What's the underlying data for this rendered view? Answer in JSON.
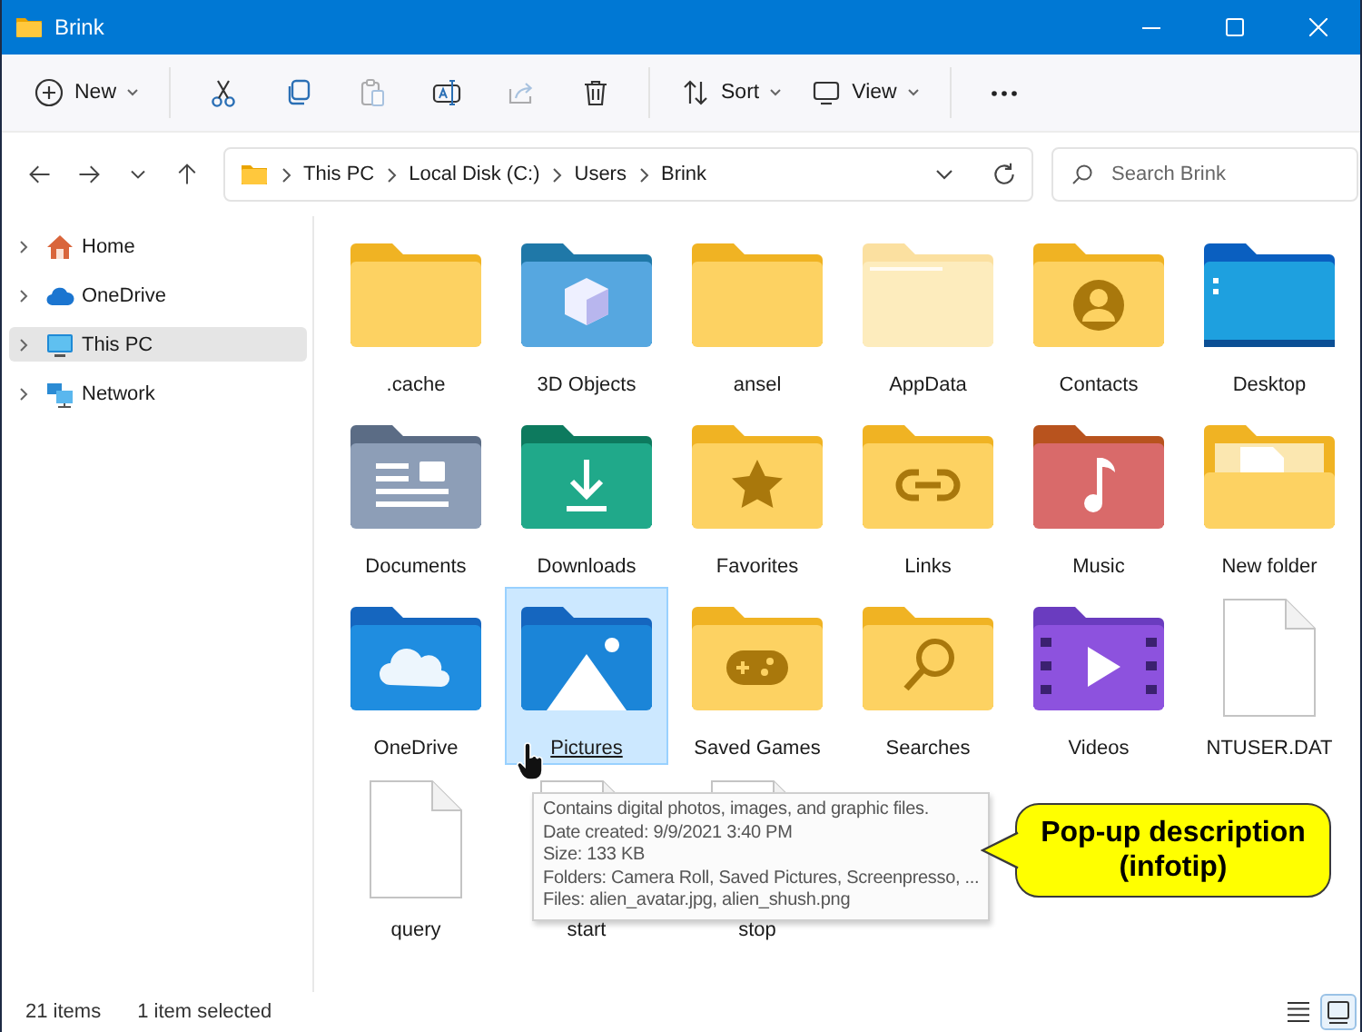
{
  "window": {
    "title": "Brink"
  },
  "toolbar": [
    {
      "kind": "new",
      "label": "New",
      "dropdown": true,
      "disabled": false
    },
    {
      "kind": "cut",
      "disabled": false
    },
    {
      "kind": "copy",
      "disabled": false
    },
    {
      "kind": "paste",
      "disabled": true
    },
    {
      "kind": "rename",
      "disabled": false
    },
    {
      "kind": "share",
      "disabled": true
    },
    {
      "kind": "delete",
      "disabled": false
    },
    {
      "kind": "sort",
      "label": "Sort",
      "dropdown": true,
      "disabled": false
    },
    {
      "kind": "view",
      "label": "View",
      "dropdown": true,
      "disabled": false
    },
    {
      "kind": "more",
      "disabled": false
    }
  ],
  "address": {
    "crumbs": [
      "This PC",
      "Local Disk (C:)",
      "Users",
      "Brink"
    ]
  },
  "search": {
    "placeholder": "Search Brink"
  },
  "sidebar": {
    "items": [
      {
        "label": "Home",
        "kind": "home",
        "selected": false
      },
      {
        "label": "OneDrive",
        "kind": "cloud",
        "selected": false
      },
      {
        "label": "This PC",
        "kind": "pc",
        "selected": true
      },
      {
        "label": "Network",
        "kind": "network",
        "selected": false
      }
    ]
  },
  "items": [
    {
      "name": ".cache",
      "kind": "plain",
      "selected": false,
      "hovered": false
    },
    {
      "name": "3D Objects",
      "kind": "cube",
      "selected": false,
      "hovered": false
    },
    {
      "name": "ansel",
      "kind": "plain",
      "selected": false,
      "hovered": false
    },
    {
      "name": "AppData",
      "kind": "faded",
      "selected": false,
      "hovered": false
    },
    {
      "name": "Contacts",
      "kind": "person",
      "selected": false,
      "hovered": false
    },
    {
      "name": "Desktop",
      "kind": "desktop",
      "selected": false,
      "hovered": false
    },
    {
      "name": "Documents",
      "kind": "documents",
      "selected": false,
      "hovered": false
    },
    {
      "name": "Downloads",
      "kind": "download",
      "selected": false,
      "hovered": false
    },
    {
      "name": "Favorites",
      "kind": "star",
      "selected": false,
      "hovered": false
    },
    {
      "name": "Links",
      "kind": "link",
      "selected": false,
      "hovered": false
    },
    {
      "name": "Music",
      "kind": "music",
      "selected": false,
      "hovered": false
    },
    {
      "name": "New folder",
      "kind": "open",
      "selected": false,
      "hovered": false
    },
    {
      "name": "OneDrive",
      "kind": "cloud",
      "selected": false,
      "hovered": false
    },
    {
      "name": "Pictures",
      "kind": "image",
      "selected": true,
      "hovered": true
    },
    {
      "name": "Saved Games",
      "kind": "gamepad",
      "selected": false,
      "hovered": false
    },
    {
      "name": "Searches",
      "kind": "search",
      "selected": false,
      "hovered": false
    },
    {
      "name": "Videos",
      "kind": "video",
      "selected": false,
      "hovered": false
    },
    {
      "name": "NTUSER.DAT",
      "kind": "file",
      "selected": false,
      "hovered": false
    },
    {
      "name": "query",
      "kind": "file",
      "selected": false,
      "hovered": false
    },
    {
      "name": "start",
      "kind": "file",
      "selected": false,
      "hovered": false
    },
    {
      "name": "stop",
      "kind": "file",
      "selected": false,
      "hovered": false
    }
  ],
  "infotip": {
    "lines": [
      "Contains digital photos, images, and graphic files.",
      "Date created: 9/9/2021 3:40 PM",
      "Size: 133 KB",
      "Folders: Camera Roll, Saved Pictures, Screenpresso, ...",
      "Files: alien_avatar.jpg, alien_shush.png"
    ]
  },
  "callout": {
    "text": "Pop-up description (infotip)"
  },
  "status_bar": {
    "count": "21 items",
    "selection": "1 item selected",
    "views": [
      {
        "kind": "details",
        "selected": false
      },
      {
        "kind": "large-icons",
        "selected": true
      }
    ]
  }
}
